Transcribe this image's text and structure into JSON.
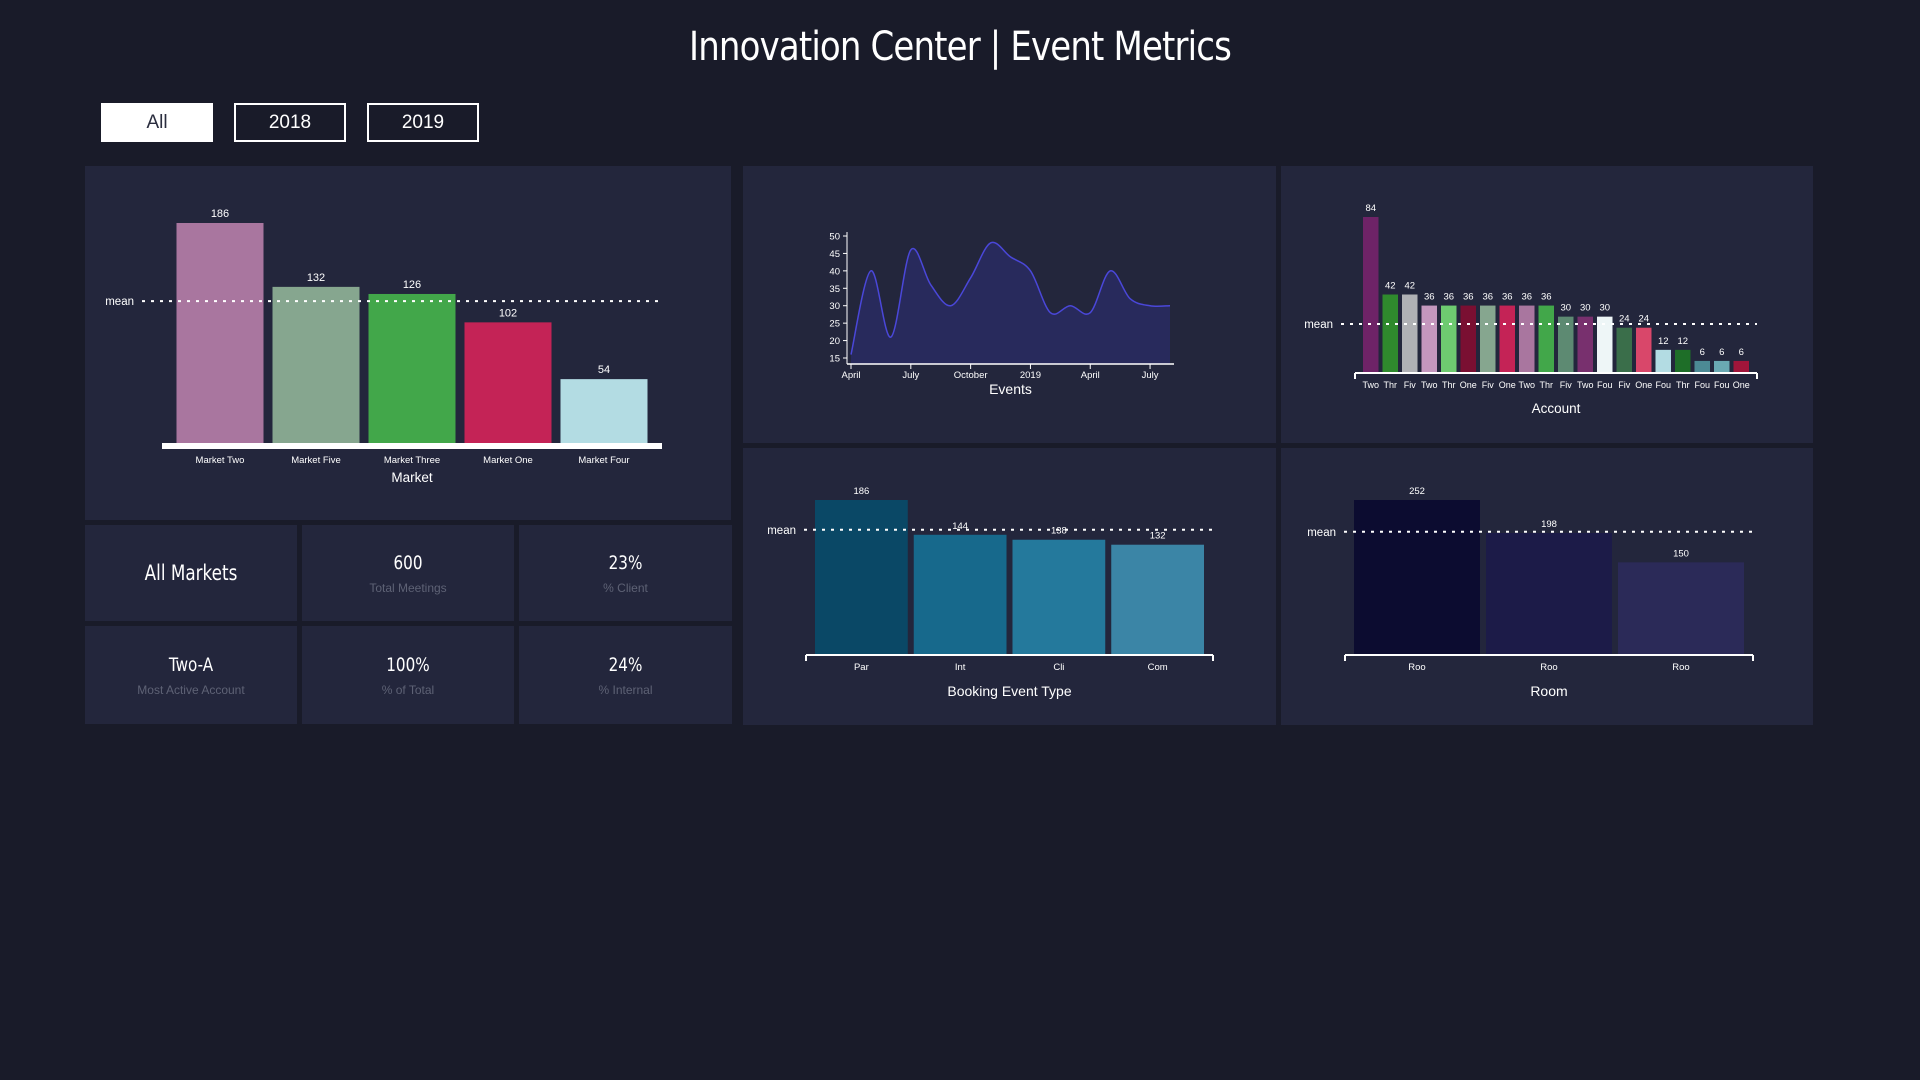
{
  "header": {
    "title": "Innovation Center | Event Metrics"
  },
  "filters": [
    {
      "label": "All",
      "active": true
    },
    {
      "label": "2018",
      "active": false
    },
    {
      "label": "2019",
      "active": false
    }
  ],
  "stats": [
    {
      "value": "All Markets",
      "label": ""
    },
    {
      "value": "600",
      "label": "Total Meetings"
    },
    {
      "value": "23%",
      "label": "% Client"
    },
    {
      "value": "Two-A",
      "label": "Most Active Account"
    },
    {
      "value": "100%",
      "label": "% of Total"
    },
    {
      "value": "24%",
      "label": "% Internal"
    }
  ],
  "chart_data": [
    {
      "id": "market",
      "type": "bar",
      "xlabel": "Market",
      "mean_label": "mean",
      "mean": 120,
      "ylim": [
        0,
        186
      ],
      "categories": [
        "Market Two",
        "Market Five",
        "Market Three",
        "Market One",
        "Market Four"
      ],
      "values": [
        186,
        132,
        126,
        102,
        54
      ],
      "colors": [
        "#a9769f",
        "#86a68f",
        "#42a74a",
        "#c42356",
        "#b3dce3"
      ]
    },
    {
      "id": "events",
      "type": "area",
      "xlabel": "Events",
      "ylim": [
        15,
        50
      ],
      "yticks": [
        15,
        20,
        25,
        30,
        35,
        40,
        45,
        50
      ],
      "xticks": [
        "April",
        "July",
        "October",
        "2019",
        "April",
        "July"
      ],
      "x": [
        "2018-04",
        "2018-05",
        "2018-06",
        "2018-07",
        "2018-08",
        "2018-09",
        "2018-10",
        "2018-11",
        "2018-12",
        "2019-01",
        "2019-02",
        "2019-03",
        "2019-04",
        "2019-05",
        "2019-06",
        "2019-07",
        "2019-08"
      ],
      "values": [
        16,
        40,
        21,
        46,
        36,
        30,
        38,
        48,
        44,
        40,
        28,
        30,
        28,
        40,
        32,
        30,
        30
      ],
      "fill": "#282a5c",
      "stroke": "#4a47d9"
    },
    {
      "id": "account",
      "type": "bar",
      "xlabel": "Account",
      "mean_label": "mean",
      "mean": 26,
      "ylim": [
        0,
        84
      ],
      "categories": [
        "Two",
        "Thr",
        "Fiv",
        "Two",
        "Thr",
        "One",
        "Fiv",
        "One",
        "Two",
        "Thr",
        "Fiv",
        "Two",
        "Fou",
        "Fiv",
        "One",
        "Fou",
        "Thr",
        "Fou",
        "Fou",
        "One"
      ],
      "values": [
        84,
        42,
        42,
        36,
        36,
        36,
        36,
        36,
        36,
        36,
        30,
        30,
        30,
        24,
        24,
        12,
        12,
        6,
        6,
        6
      ],
      "colors": [
        "#6e2367",
        "#2f8a2d",
        "#b0b1b5",
        "#c497be",
        "#6ecb70",
        "#7a0f32",
        "#86a68f",
        "#c42356",
        "#a9769f",
        "#42a74a",
        "#5d8a72",
        "#78306e",
        "#eef6f7",
        "#3a6e4a",
        "#d9476a",
        "#b3dce3",
        "#1e6e28",
        "#4c8a95",
        "#6aa9b3",
        "#a1153a"
      ]
    },
    {
      "id": "booking",
      "type": "bar",
      "xlabel": "Booking Event Type",
      "mean_label": "mean",
      "mean": 150,
      "ylim": [
        0,
        186
      ],
      "categories": [
        "Par",
        "Int",
        "Cli",
        "Com"
      ],
      "values": [
        186,
        144,
        138,
        132
      ],
      "colors": [
        "#0a4866",
        "#17698c",
        "#24799c",
        "#3b85a6"
      ]
    },
    {
      "id": "room",
      "type": "bar",
      "xlabel": "Room",
      "mean_label": "mean",
      "mean": 200,
      "ylim": [
        0,
        252
      ],
      "categories": [
        "Roo",
        "Roo",
        "Roo"
      ],
      "values": [
        252,
        198,
        150
      ],
      "colors": [
        "#0c0c30",
        "#1c1b48",
        "#2b2a58"
      ]
    }
  ]
}
